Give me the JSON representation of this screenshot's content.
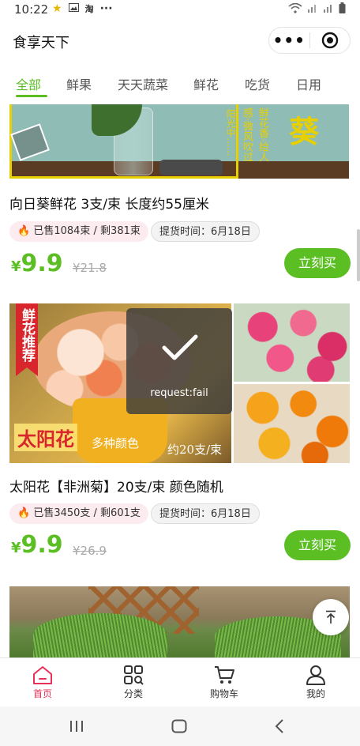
{
  "status": {
    "time": "10:22"
  },
  "app": {
    "title": "食享天下",
    "more_label": "•••"
  },
  "tabs": [
    {
      "label": "全部",
      "active": true
    },
    {
      "label": "鲜果",
      "active": false
    },
    {
      "label": "天天蔬菜",
      "active": false
    },
    {
      "label": "鲜花",
      "active": false
    },
    {
      "label": "吃货",
      "active": false
    },
    {
      "label": "日用",
      "active": false
    }
  ],
  "products": [
    {
      "image_text": {
        "main": "葵",
        "side_a": "鲜花香·给人",
        "side_b": "感·微风吹过",
        "side_c": "阳光中……"
      },
      "title": "向日葵鲜花 3支/束 长度约55厘米",
      "sold": "已售1084束 / 剩381束",
      "ship": "提货时间：6月18日",
      "currency": "¥",
      "price": "9.9",
      "old_price": "¥21.8",
      "buy_label": "立刻买"
    },
    {
      "image_text": {
        "badge": "鲜花推荐",
        "name": "太阳花",
        "colors": "多种颜色",
        "count": "约20支/束"
      },
      "title": "太阳花【非洲菊】20支/束 颜色随机",
      "sold": "已售3450支 / 剩601支",
      "ship": "提货时间：6月18日",
      "currency": "¥",
      "price": "9.9",
      "old_price": "¥26.9",
      "buy_label": "立刻买"
    }
  ],
  "toast": {
    "message": "request:fail"
  },
  "tabbar": [
    {
      "label": "首页",
      "icon": "home-icon",
      "active": true
    },
    {
      "label": "分类",
      "icon": "category-icon",
      "active": false
    },
    {
      "label": "购物车",
      "icon": "cart-icon",
      "active": false
    },
    {
      "label": "我的",
      "icon": "user-icon",
      "active": false
    }
  ],
  "colors": {
    "accent": "#5bbf24",
    "tab_active": "#e8305a",
    "sold_bg": "#fdecef"
  }
}
